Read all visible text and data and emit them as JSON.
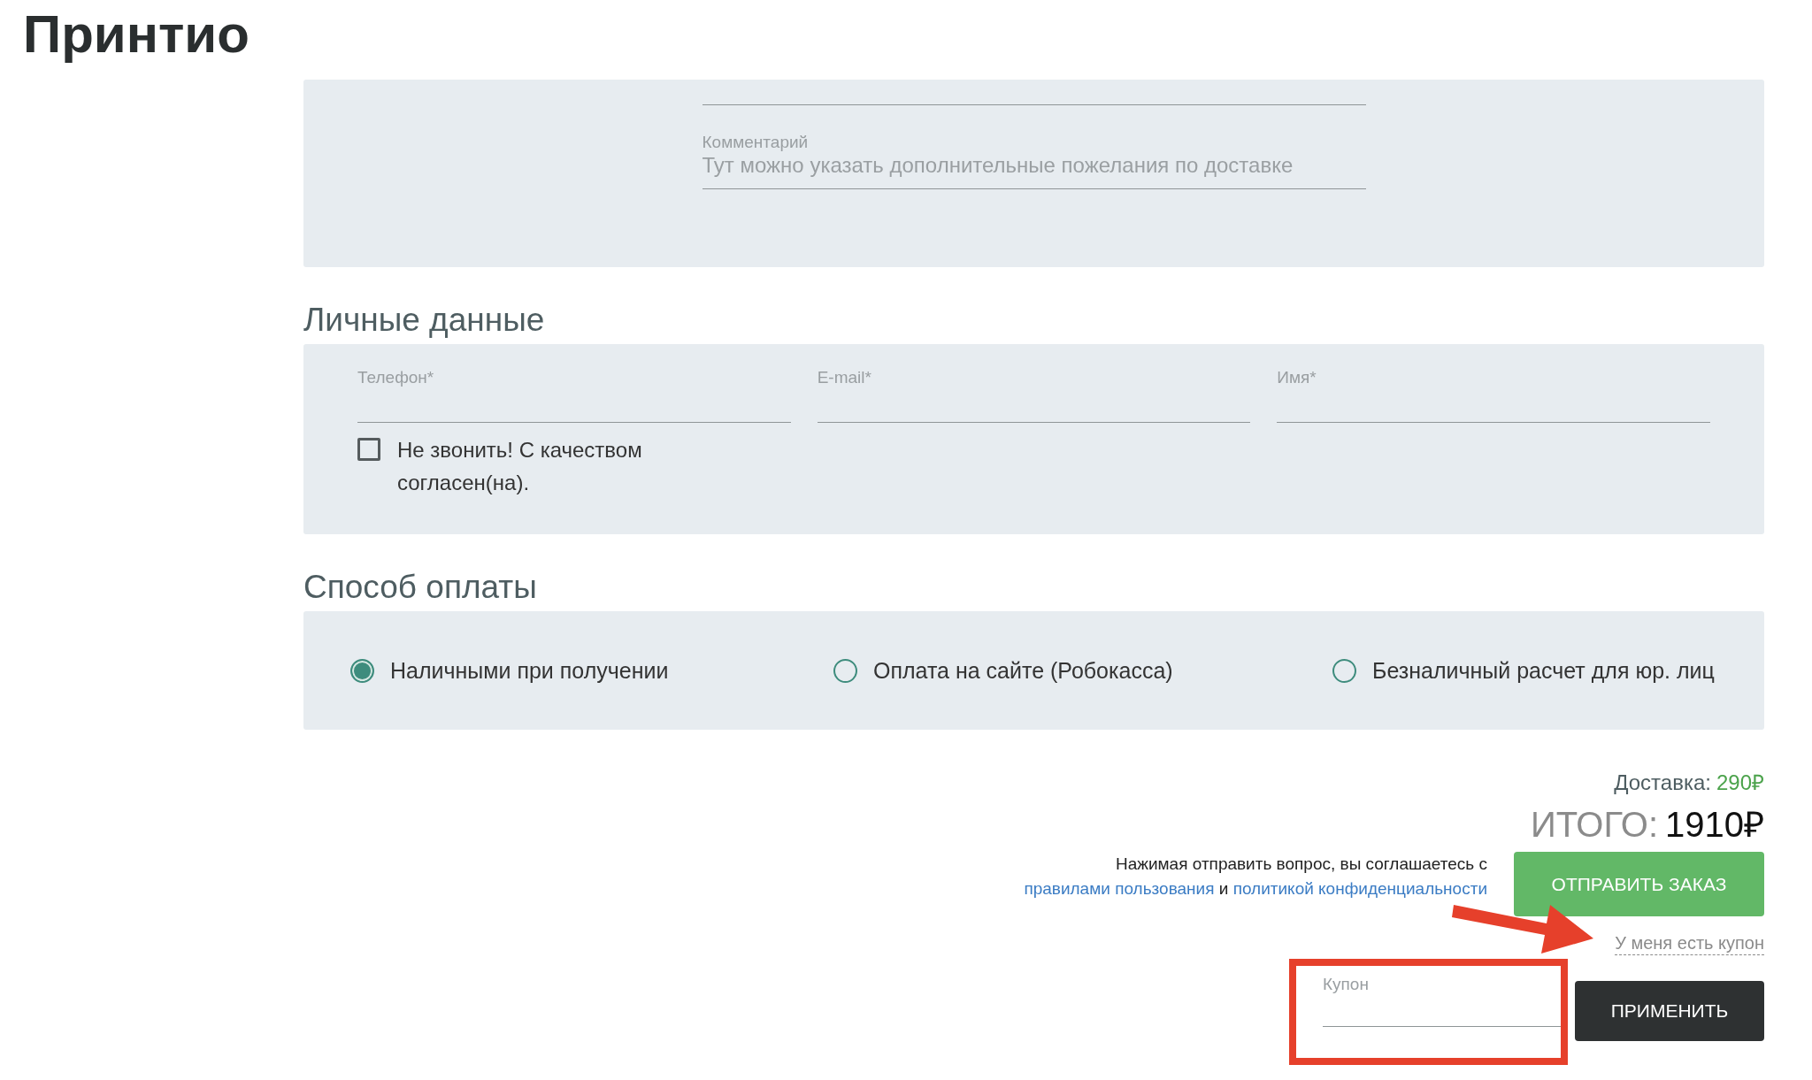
{
  "logo": {
    "text": "Принтио"
  },
  "comment_section": {
    "fields": [
      {
        "kind": "blank"
      },
      {
        "kind": "text",
        "label": "Комментарий",
        "placeholder": "Тут можно указать дополнительные пожелания по доставке"
      }
    ]
  },
  "personal_data": {
    "title": "Личные данные",
    "fields": [
      {
        "label": "Телефон*"
      },
      {
        "label": "E-mail*"
      },
      {
        "label": "Имя*"
      }
    ],
    "no_call": {
      "label": "Не звонить! С качеством согласен(на).",
      "checked": false
    }
  },
  "payment": {
    "title": "Способ оплаты",
    "options": [
      {
        "label": "Наличными при получении",
        "selected": true
      },
      {
        "label": "Оплата на сайте (Робокасса)",
        "selected": false
      },
      {
        "label": "Безналичный расчет для юр. лиц",
        "selected": false
      }
    ]
  },
  "summary": {
    "delivery_label": "Доставка:",
    "delivery_price": "290₽",
    "total_label": "ИТОГО:",
    "total_value": "1910₽"
  },
  "consent": {
    "text": "Нажимая отправить вопрос, вы соглашаетесь с",
    "link_1": "правилами пользования",
    "middle": "и",
    "link_2": "политикой конфиденциальности"
  },
  "submit_button": "ОТПРАВИТЬ ЗАКАЗ",
  "coupon": {
    "toggle": "У меня есть купон",
    "field": {
      "label": "Купон"
    },
    "apply_button": "ПРИМЕНИТЬ"
  },
  "annotations": {
    "arrow": true,
    "frame": true
  }
}
